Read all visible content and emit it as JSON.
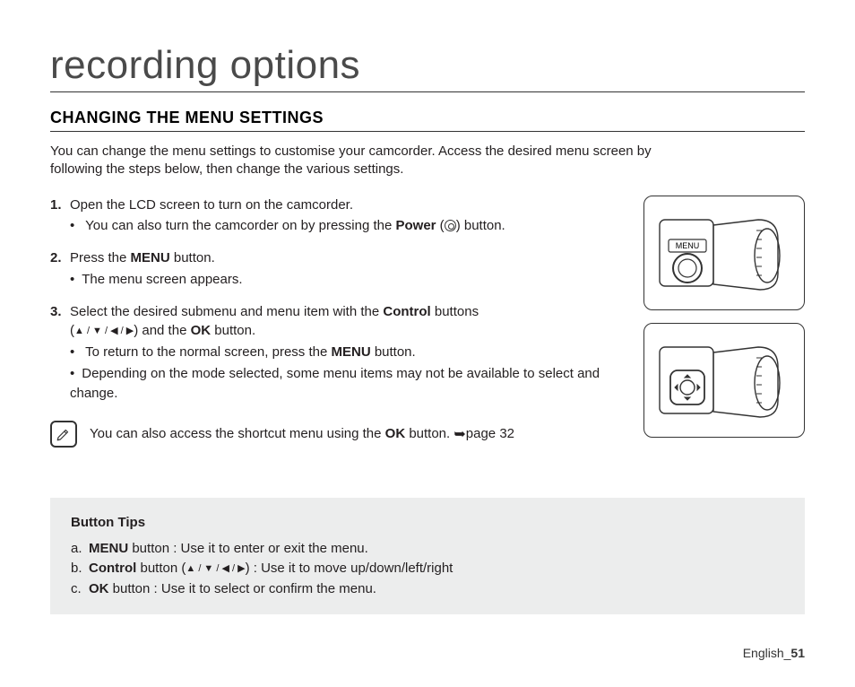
{
  "title": "recording options",
  "subtitle": "CHANGING THE MENU SETTINGS",
  "intro": "You can change the menu settings to customise your camcorder. Access the desired menu screen by following the steps below, then change the various settings.",
  "steps": [
    {
      "num": "1.",
      "text": "Open the LCD screen to turn on the camcorder.",
      "sub": [
        {
          "pre": "You can also turn the camcorder on by pressing the ",
          "bold": "Power",
          "post": " (",
          "icon": "power",
          "post2": ") button."
        }
      ]
    },
    {
      "num": "2.",
      "text_pre": "Press the ",
      "text_bold": "MENU",
      "text_post": " button.",
      "sub": [
        {
          "plain": "The menu screen appears."
        }
      ]
    },
    {
      "num": "3.",
      "text_pre": "Select the desired submenu and menu item with the ",
      "text_bold": "Control",
      "text_post": " buttons",
      "line2_pre": "(",
      "arrows": "▲ / ▼ / ◀ / ▶",
      "line2_mid": ") and the ",
      "line2_bold": "OK",
      "line2_post": " button.",
      "sub": [
        {
          "pre": "To return to the normal screen, press the ",
          "bold": "MENU",
          "post": " button."
        },
        {
          "plain": "Depending on the mode selected, some menu items may not be available to select and change."
        }
      ]
    }
  ],
  "note": {
    "pre": "You can also access the shortcut menu using the ",
    "bold": "OK",
    "post": " button. ",
    "ref": "page 32"
  },
  "fig1_label": "MENU",
  "tips": {
    "title": "Button Tips",
    "items": [
      {
        "key": "a.",
        "bold": "MENU",
        "rest": " button : Use it to enter or exit the menu."
      },
      {
        "key": "b.",
        "bold": "Control",
        "rest_pre": " button (",
        "arrows": "▲ / ▼ / ◀ / ▶",
        "rest_post": ") : Use it to move up/down/left/right"
      },
      {
        "key": "c.",
        "bold": "OK",
        "rest": " button : Use it to select or confirm the menu."
      }
    ]
  },
  "footer": {
    "lang": "English",
    "sep": "_",
    "page": "51"
  }
}
